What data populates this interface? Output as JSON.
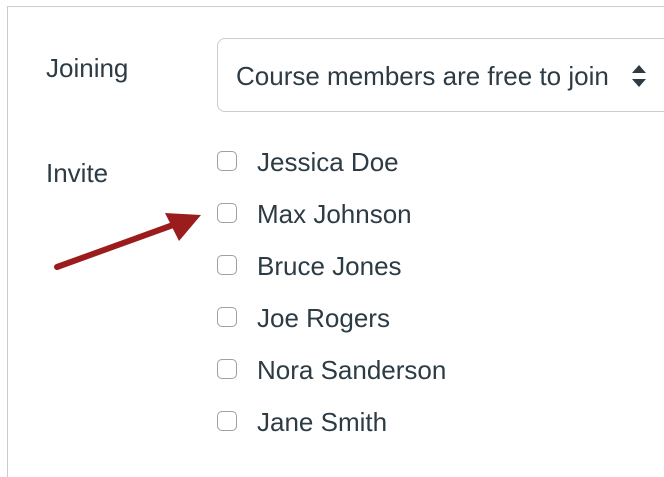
{
  "form": {
    "joining": {
      "label": "Joining",
      "select_value": "Course members are free to join"
    },
    "invite": {
      "label": "Invite",
      "members": [
        {
          "name": "Jessica Doe",
          "checked": false
        },
        {
          "name": "Max Johnson",
          "checked": false
        },
        {
          "name": "Bruce Jones",
          "checked": false
        },
        {
          "name": "Joe Rogers",
          "checked": false
        },
        {
          "name": "Nora Sanderson",
          "checked": false
        },
        {
          "name": "Jane Smith",
          "checked": false
        }
      ]
    }
  },
  "colors": {
    "text": "#2d3b45",
    "border": "#c7cdd1",
    "annotation_arrow": "#9b1c1c"
  },
  "annotation": {
    "type": "arrow",
    "points_to": "Max Johnson checkbox"
  }
}
